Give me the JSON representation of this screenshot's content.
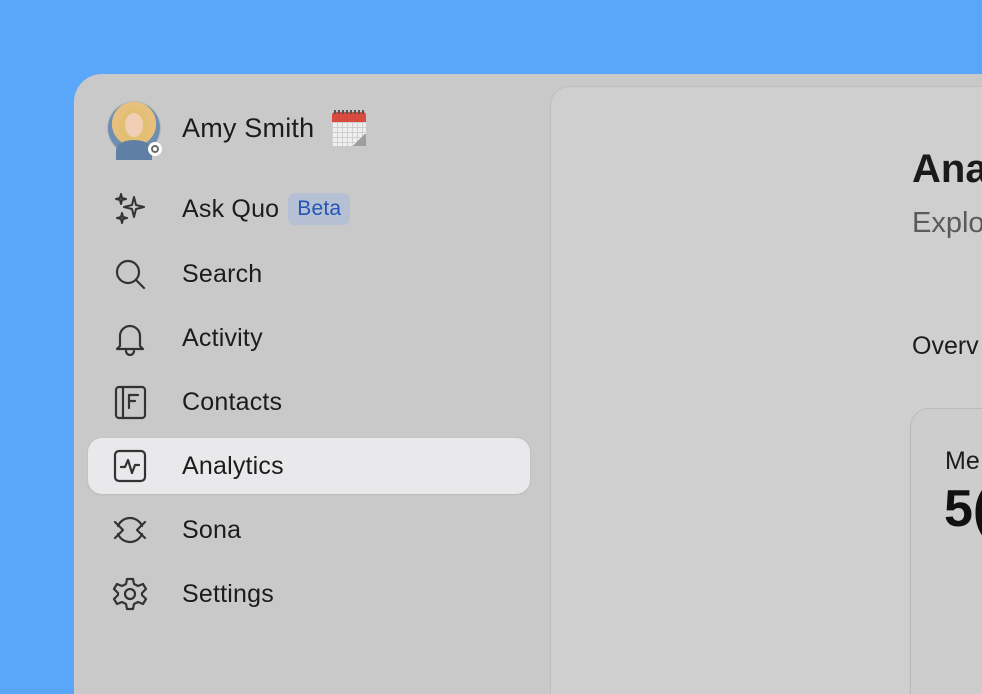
{
  "profile": {
    "name": "Amy Smith",
    "status_icon": "settings-status-icon",
    "emoji": "spiral-calendar-emoji"
  },
  "nav": {
    "items": [
      {
        "label": "Ask Quo",
        "icon": "sparkles-icon",
        "badge": "Beta",
        "active": false
      },
      {
        "label": "Search",
        "icon": "search-icon",
        "active": false
      },
      {
        "label": "Activity",
        "icon": "bell-icon",
        "active": false
      },
      {
        "label": "Contacts",
        "icon": "contacts-book-icon",
        "active": false
      },
      {
        "label": "Analytics",
        "icon": "analytics-pulse-icon",
        "active": true
      },
      {
        "label": "Sona",
        "icon": "sona-icon",
        "active": false
      },
      {
        "label": "Settings",
        "icon": "gear-icon",
        "active": false
      }
    ]
  },
  "main": {
    "title": "Ana",
    "subtitle": "Explo",
    "tab": "Overv",
    "card": {
      "label": "Me",
      "value": "5("
    }
  },
  "colors": {
    "background": "#5aa6f8",
    "sidebar": "#c9c9c9",
    "active_item": "#e9e9eb",
    "badge_text": "#2454b4",
    "badge_bg": "#b6c0d4"
  }
}
